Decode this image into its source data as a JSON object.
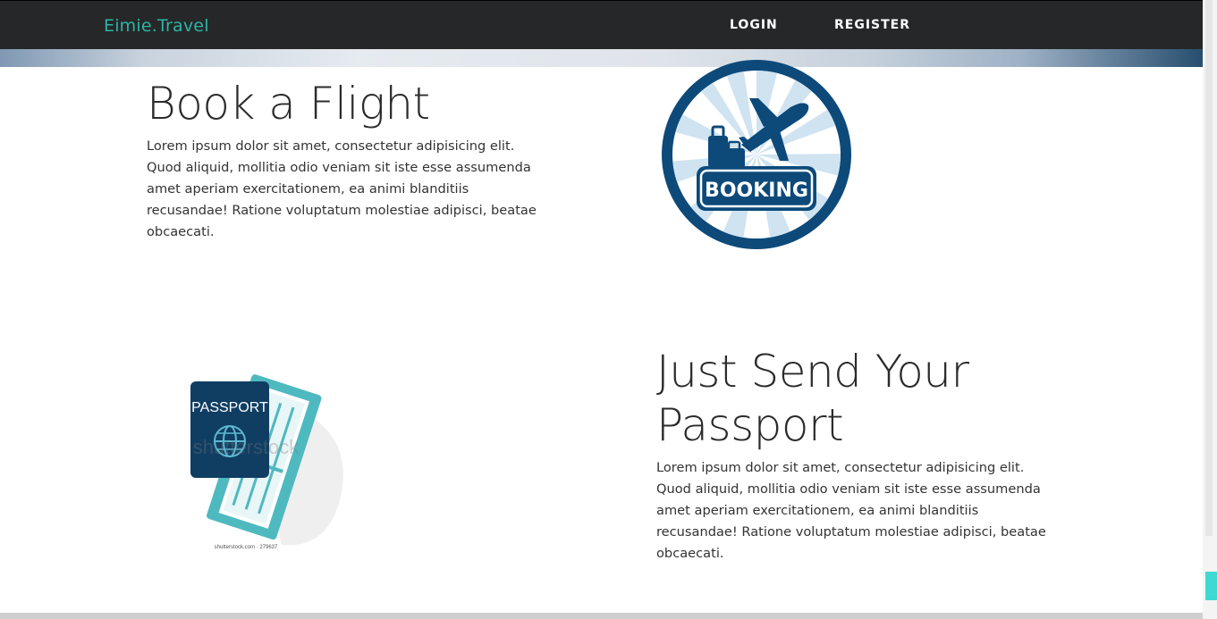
{
  "navbar": {
    "brand": "Eimie.Travel",
    "links": [
      "LOGIN",
      "REGISTER"
    ]
  },
  "sections": [
    {
      "title": "Book a Flight",
      "text": "Lorem ipsum dolor sit amet, consectetur adipisicing elit. Quod aliquid, mollitia odio veniam sit iste esse assumenda amet aperiam exercitationem, ea animi blanditiis recusandae! Ratione voluptatum molestiae adipisci, beatae obcaecati.",
      "image_label": "BOOKING"
    },
    {
      "title": "Just Send Your Passport",
      "text": "Lorem ipsum dolor sit amet, consectetur adipisicing elit. Quod aliquid, mollitia odio veniam sit iste esse assumenda amet aperiam exercitationem, ea animi blanditiis recusandae! Ratione voluptatum molestiae adipisci, beatae obcaecati.",
      "image_label": "PASSPORT",
      "image_watermark": "shutterstock",
      "image_caption": "shutterstock.com · 279637"
    }
  ],
  "colors": {
    "navbar_bg": "#262728",
    "brand": "#2cb5a8",
    "booking_blue": "#0d4a7a",
    "passport_navy": "#103e63",
    "ticket_teal": "#4fb9c0"
  }
}
